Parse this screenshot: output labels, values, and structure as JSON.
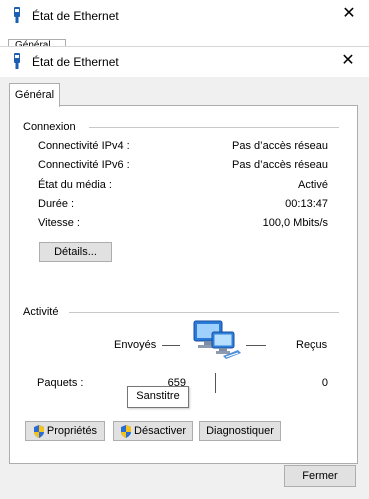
{
  "back_window": {
    "title": "État de Ethernet",
    "tab_fragment": "Général"
  },
  "window": {
    "title": "État de Ethernet",
    "tab_label": "Général"
  },
  "connexion": {
    "group_label": "Connexion",
    "rows": [
      {
        "label": "Connectivité IPv4 :",
        "value": "Pas d’accès réseau"
      },
      {
        "label": "Connectivité IPv6 :",
        "value": "Pas d’accès réseau"
      },
      {
        "label": "État du média :",
        "value": "Activé"
      },
      {
        "label": "Durée :",
        "value": "00:13:47"
      },
      {
        "label": "Vitesse :",
        "value": "100,0 Mbits/s"
      }
    ],
    "details_button": "Détails..."
  },
  "activite": {
    "group_label": "Activité",
    "sent_label": "Envoyés",
    "received_label": "Reçus",
    "packets_label": "Paquets :",
    "packets_sent": "659",
    "packets_received": "0"
  },
  "buttons": {
    "properties": "Propriétés",
    "disable": "Désactiver",
    "diagnose": "Diagnostiquer",
    "close": "Fermer"
  },
  "tooltip": "Sanstitre",
  "colors": {
    "window_bg": "#f0f0f0",
    "panel_bg": "#ffffff",
    "border": "#adadad",
    "button_bg": "#e1e1e1",
    "icon_blue": "#1a5fb4"
  }
}
